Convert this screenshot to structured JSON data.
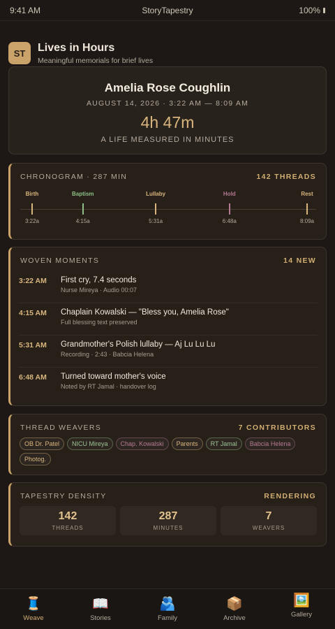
{
  "status": {
    "time": "9:41 AM",
    "app": "StoryTapestry",
    "battery": "100%"
  },
  "header": {
    "logo": "ST",
    "title": "Lives in Hours",
    "subtitle": "Meaningful memorials for brief lives"
  },
  "hero": {
    "name": "Amelia Rose Coughlin",
    "dates": "AUGUST 14, 2026 · 3:22 AM — 8:09 AM",
    "duration": "4h 47m",
    "caption": "A LIFE MEASURED IN MINUTES"
  },
  "chronogram": {
    "title": "CHRONOGRAM · 287 MIN",
    "right": "142 THREADS",
    "ticks": [
      {
        "label": "Birth",
        "time": "3:22a",
        "color": "#d9b57e",
        "minute": 0
      },
      {
        "label": "Baptism",
        "time": "4:15a",
        "color": "#8fbf86",
        "minute": 53
      },
      {
        "label": "Lullaby",
        "time": "5:31a",
        "color": "#d9b57e",
        "minute": 129
      },
      {
        "label": "Hold",
        "time": "6:48a",
        "color": "#b57a93",
        "minute": 206
      },
      {
        "label": "Rest",
        "time": "8:09a",
        "color": "#d9b57e",
        "minute": 287
      }
    ]
  },
  "moments": {
    "title": "WOVEN MOMENTS",
    "right": "14 NEW",
    "items": [
      {
        "time": "3:22 AM",
        "title": "First cry, 7.4 seconds",
        "sub": "Nurse Mireya · Audio 00:07"
      },
      {
        "time": "4:15 AM",
        "title": "Chaplain Kowalski — \"Bless you, Amelia Rose\"",
        "sub": "Full blessing text preserved"
      },
      {
        "time": "5:31 AM",
        "title": "Grandmother's Polish lullaby — Aj Lu Lu Lu",
        "sub": "Recording · 2:43 · Babcia Helena"
      },
      {
        "time": "6:48 AM",
        "title": "Turned toward mother's voice",
        "sub": "Noted by RT Jamal · handover log"
      }
    ]
  },
  "weavers": {
    "title": "THREAD WEAVERS",
    "right": "7 CONTRIBUTORS",
    "chips": [
      {
        "label": "OB Dr. Patel",
        "color": "#d9b57e"
      },
      {
        "label": "NICU Mireya",
        "color": "#9cc394"
      },
      {
        "label": "Chap. Kowalski",
        "color": "#b57a93"
      },
      {
        "label": "Parents",
        "color": "#d9b57e"
      },
      {
        "label": "RT Jamal",
        "color": "#9cc394"
      },
      {
        "label": "Babcia Helena",
        "color": "#b57a93"
      },
      {
        "label": "Photog.",
        "color": "#d9b57e"
      }
    ]
  },
  "density": {
    "title": "TAPESTRY DENSITY",
    "right": "RENDERING",
    "stats": [
      {
        "value": "142",
        "label": "THREADS"
      },
      {
        "value": "287",
        "label": "MINUTES"
      },
      {
        "value": "7",
        "label": "WEAVERS"
      }
    ]
  },
  "nav": [
    {
      "label": "Weave",
      "icon": "🧵",
      "name": "thread-spool-icon"
    },
    {
      "label": "Stories",
      "icon": "📖",
      "name": "open-book-icon"
    },
    {
      "label": "Family",
      "icon": "🫂",
      "name": "family-icon"
    },
    {
      "label": "Archive",
      "icon": "📦",
      "name": "box-icon"
    },
    {
      "label": "Gallery",
      "icon": "🖼️",
      "name": "framed-picture-icon"
    }
  ]
}
